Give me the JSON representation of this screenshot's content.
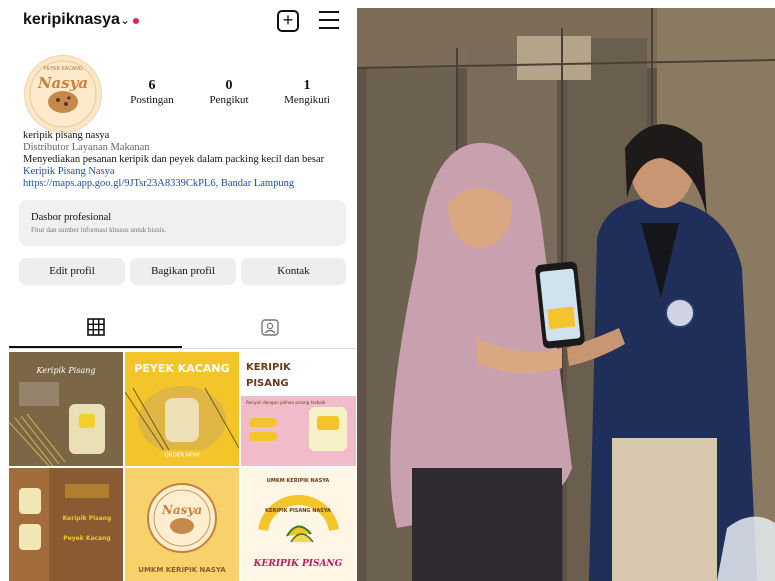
{
  "profile": {
    "username": "keripiknasya",
    "avatar_text": "Nasya",
    "avatar_ring_text": "PEYEK KACANG"
  },
  "stats": [
    {
      "value": "6",
      "label": "Postingan"
    },
    {
      "value": "0",
      "label": "Pengikut"
    },
    {
      "value": "1",
      "label": "Mengikuti"
    }
  ],
  "bio": {
    "name": "keripik pisang nasya",
    "category": "Distributor Layanan Makanan",
    "description": "Menyediakan pesanan keripik dan peyek dalam packing kecil dan besar",
    "link_name": "Keripik Pisang Nasya",
    "link_url": "https://maps.app.goo.gl/9JTsr23A8339CkPL6, Bandar Lampung"
  },
  "dashboard": {
    "title": "Dasbor profesional",
    "subtitle": "Fitur dan sumber informasi khusus untuk bisnis."
  },
  "buttons": {
    "edit": "Edit profil",
    "share": "Bagikan profil",
    "contact": "Kontak"
  },
  "posts": [
    {
      "title": "Keripik Pisang"
    },
    {
      "title": "PEYEK KACANG",
      "caption": "ORDER NOW"
    },
    {
      "title": "KERIPIK PISANG",
      "subtitle": "Renyah dengan pilihan pisang terbaik"
    },
    {
      "title": "Keripik Pisang",
      "subtitle": "Peyek Kacang"
    },
    {
      "title": "Nasya",
      "caption": "UMKM KERIPIK NASYA"
    },
    {
      "title": "KERIPIK PISANG NASYA",
      "header": "UMKM KERIPIK NASYA",
      "caption": "KERIPIK PISANG"
    }
  ],
  "colors": {
    "accent_yellow": "#f6c21f",
    "link_blue": "#1b4f9a",
    "notification_red": "#e0245e"
  }
}
